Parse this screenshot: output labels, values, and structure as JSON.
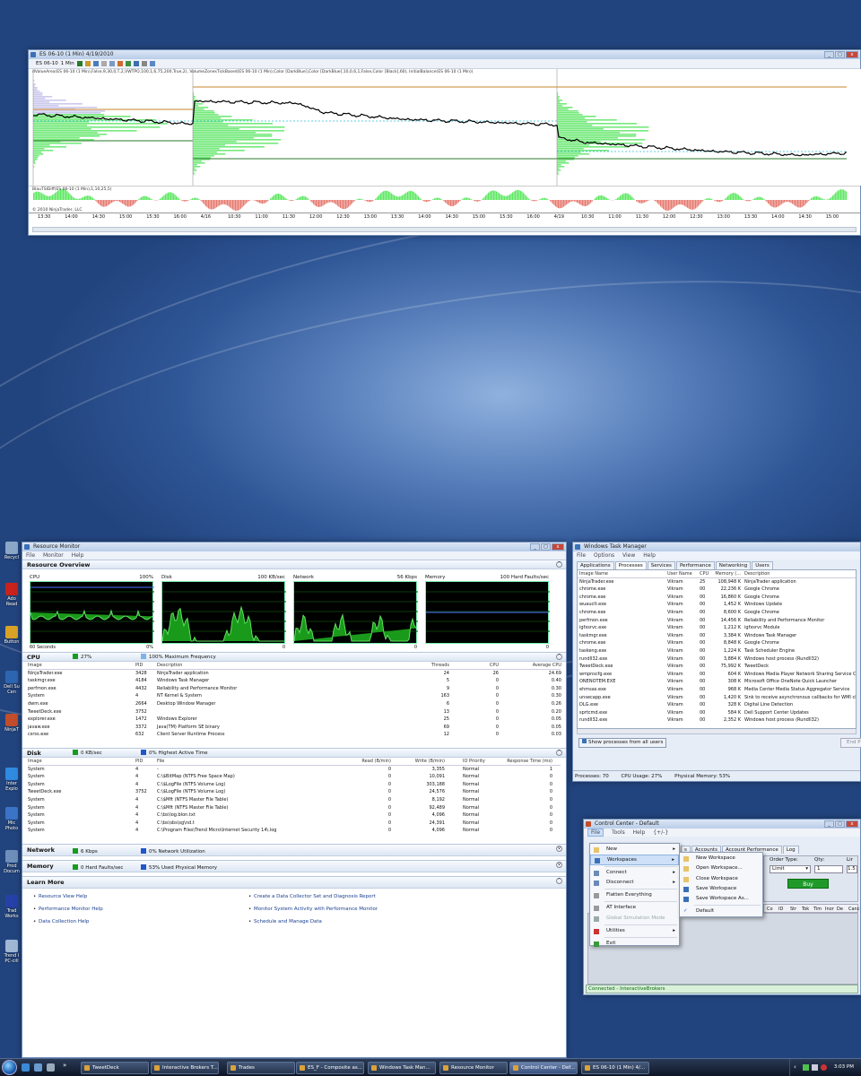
{
  "desktop": {
    "icons": [
      {
        "label": "Recycl",
        "color": "#8aa7c8"
      },
      {
        "label": "Ado Read",
        "color": "#c7221b"
      },
      {
        "label": "Button",
        "color": "#d9a227"
      },
      {
        "label": "Dell Su Cen",
        "color": "#2c66b0"
      },
      {
        "label": "NinjaT",
        "color": "#c24d2a"
      },
      {
        "label": "Inter Explo",
        "color": "#2f8ae0"
      },
      {
        "label": "Mic Photo",
        "color": "#3b74c7"
      },
      {
        "label": "Prod Docum",
        "color": "#6e8fba"
      },
      {
        "label": "Trad Works",
        "color": "#2541a8"
      },
      {
        "label": "Trend I PC-cill",
        "color": "#9fb6d4"
      }
    ]
  },
  "chart_window": {
    "title": "ES 06-10 (1 Min)  4/19/2010",
    "instrument": "ES 06-10",
    "interval": "1 Min",
    "indicator_label": "dValueArea(ES 06-10 (1 Min),False,9,30,0,T,2,VWTPO,100,1,6,75,200,True,2), VolumeZonesTickBased(ES 06-10 (1 Min),Color [DarkBlue],Color [DarkBlue],10,0,6,1,False,Color [Black],60), InitialBalance(ES 06-10 (1 Min))",
    "lower_panel_label": "BlauTSIDiff(ES 06-10 (1 Min),1,10,25,5)",
    "copyright": "© 2010 NinjaTrader, LLC",
    "x_ticks": [
      "13:30",
      "14:00",
      "14:30",
      "15:00",
      "15:30",
      "16:00",
      "4/16",
      "10:30",
      "11:00",
      "11:30",
      "12:00",
      "12:30",
      "13:00",
      "13:30",
      "14:00",
      "14:30",
      "15:00",
      "15:30",
      "16:00",
      "4/19",
      "10:30",
      "11:00",
      "11:30",
      "12:00",
      "12:30",
      "13:00",
      "13:30",
      "14:00",
      "14:30",
      "15:00"
    ]
  },
  "resource_monitor": {
    "title": "Resource Monitor",
    "menu": [
      "File",
      "Monitor",
      "Help"
    ],
    "overview_title": "Resource Overview",
    "graphs": [
      {
        "name": "CPU",
        "max": "100%",
        "left": "60 Seconds",
        "right": "0%"
      },
      {
        "name": "Disk",
        "max": "100 KB/sec",
        "left": "",
        "right": "0"
      },
      {
        "name": "Network",
        "max": "56 Kbps",
        "left": "",
        "right": "0"
      },
      {
        "name": "Memory",
        "max": "100 Hard Faults/sec",
        "left": "",
        "right": "0"
      }
    ],
    "cpu": {
      "title": "CPU",
      "usage": "27%",
      "freq": "100% Maximum Frequency",
      "headers": [
        "Image",
        "PID",
        "Description",
        "Threads",
        "CPU",
        "Average CPU"
      ],
      "rows": [
        [
          "NinjaTrader.exe",
          "3428",
          "NinjaTrader application",
          "24",
          "26",
          "24.69"
        ],
        [
          "taskmgr.exe",
          "4184",
          "Windows Task Manager",
          "5",
          "0",
          "0.40"
        ],
        [
          "perfmon.exe",
          "4432",
          "Reliability and Performance Monitor",
          "9",
          "0",
          "0.30"
        ],
        [
          "System",
          "4",
          "NT Kernel & System",
          "163",
          "0",
          "0.30"
        ],
        [
          "dwm.exe",
          "2664",
          "Desktop Window Manager",
          "6",
          "0",
          "0.26"
        ],
        [
          "TweetDeck.exe",
          "3752",
          "",
          "13",
          "0",
          "0.20"
        ],
        [
          "explorer.exe",
          "1472",
          "Windows Explorer",
          "25",
          "0",
          "0.05"
        ],
        [
          "javaw.exe",
          "3372",
          "Java(TM) Platform SE binary",
          "69",
          "0",
          "0.05"
        ],
        [
          "csrss.exe",
          "632",
          "Client Server Runtime Process",
          "12",
          "0",
          "0.03"
        ]
      ]
    },
    "disk": {
      "title": "Disk",
      "usage": "0 KB/sec",
      "active": "0% Highest Active Time",
      "headers": [
        "Image",
        "PID",
        "File",
        "Read (B/min)",
        "Write (B/min)",
        "IO Priority",
        "Response Time (ms)"
      ],
      "rows": [
        [
          "System",
          "4",
          "-",
          "0",
          "3,355",
          "Normal",
          "1"
        ],
        [
          "System",
          "4",
          "C:\\$BitMap (NTFS Free Space Map)",
          "0",
          "10,091",
          "Normal",
          "0"
        ],
        [
          "System",
          "4",
          "C:\\$LogFile (NTFS Volume Log)",
          "0",
          "303,188",
          "Normal",
          "0"
        ],
        [
          "TweetDeck.exe",
          "3752",
          "C:\\$LogFile (NTFS Volume Log)",
          "0",
          "24,576",
          "Normal",
          "0"
        ],
        [
          "System",
          "4",
          "C:\\$Mft (NTFS Master File Table)",
          "0",
          "8,192",
          "Normal",
          "0"
        ],
        [
          "System",
          "4",
          "C:\\$Mft (NTFS Master File Table)",
          "0",
          "92,489",
          "Normal",
          "0"
        ],
        [
          "System",
          "4",
          "C:\\bs\\log.blon.txt",
          "0",
          "4,096",
          "Normal",
          "0"
        ],
        [
          "System",
          "4",
          "C:\\bs\\sbs\\sg\\nd.t",
          "0",
          "24,391",
          "Normal",
          "0"
        ],
        [
          "System",
          "4",
          "C:\\Program Files\\Trend Micro\\Internet Security 14\\.log",
          "0",
          "4,096",
          "Normal",
          "0"
        ]
      ]
    },
    "network": {
      "title": "Network",
      "usage": "6 Kbps",
      "util": "0% Network Utilization"
    },
    "memory": {
      "title": "Memory",
      "usage": "0 Hard Faults/sec",
      "used": "53% Used Physical Memory"
    },
    "learn": {
      "title": "Learn More",
      "links": [
        "Resource View Help",
        "Create a Data Collector Set and Diagnosis Report",
        "Performance Monitor Help",
        "Monitor System Activity with Performance Monitor",
        "Data Collection Help",
        "Schedule and Manage Data"
      ]
    }
  },
  "task_manager": {
    "title": "Windows Task Manager",
    "menu": [
      "File",
      "Options",
      "View",
      "Help"
    ],
    "tabs": [
      "Applications",
      "Processes",
      "Services",
      "Performance",
      "Networking",
      "Users"
    ],
    "active_tab": "Processes",
    "headers": [
      "Image Name",
      "User Name",
      "CPU",
      "Memory (...",
      "Description"
    ],
    "rows": [
      [
        "NinjaTrader.exe",
        "Vikram",
        "25",
        "108,948 K",
        "NinjaTrader application"
      ],
      [
        "chrome.exe",
        "Vikram",
        "00",
        "22,236 K",
        "Google Chrome"
      ],
      [
        "chrome.exe",
        "Vikram",
        "00",
        "16,860 K",
        "Google Chrome"
      ],
      [
        "wuauclt.exe",
        "Vikram",
        "00",
        "1,452 K",
        "Windows Update"
      ],
      [
        "chrome.exe",
        "Vikram",
        "00",
        "8,600 K",
        "Google Chrome"
      ],
      [
        "perfmon.exe",
        "Vikram",
        "00",
        "14,456 K",
        "Reliability and Performance Monitor"
      ],
      [
        "igfxsrvc.exe",
        "Vikram",
        "00",
        "1,212 K",
        "igfxsrvc Module"
      ],
      [
        "taskmgr.exe",
        "Vikram",
        "00",
        "3,384 K",
        "Windows Task Manager"
      ],
      [
        "chrome.exe",
        "Vikram",
        "00",
        "8,848 K",
        "Google Chrome"
      ],
      [
        "taskeng.exe",
        "Vikram",
        "00",
        "1,224 K",
        "Task Scheduler Engine"
      ],
      [
        "rundll32.exe",
        "Vikram",
        "00",
        "3,884 K",
        "Windows host process (Rundll32)"
      ],
      [
        "TweetDeck.exe",
        "Vikram",
        "00",
        "75,992 K",
        "TweetDeck"
      ],
      [
        "wmpnscfg.exe",
        "Vikram",
        "00",
        "604 K",
        "Windows Media Player Network Sharing Service Conf"
      ],
      [
        "ONENOTEM.EXE",
        "Vikram",
        "00",
        "308 K",
        "Microsoft Office OneNote Quick Launcher"
      ],
      [
        "ehmsas.exe",
        "Vikram",
        "00",
        "968 K",
        "Media Center Media Status Aggregator Service"
      ],
      [
        "unsecapp.exe",
        "Vikram",
        "00",
        "1,420 K",
        "Sink to receive asynchronous callbacks for WMI clien"
      ],
      [
        "DLG.exe",
        "Vikram",
        "00",
        "328 K",
        "Digital Line Detection"
      ],
      [
        "sprtcmd.exe",
        "Vikram",
        "00",
        "584 K",
        "Dell Support Center Updates"
      ],
      [
        "rundll32.exe",
        "Vikram",
        "00",
        "2,352 K",
        "Windows host process (Rundll32)"
      ]
    ],
    "show_all": "Show processes from all users",
    "end_btn": "End P",
    "status": [
      "Processes: 70",
      "CPU Usage: 27%",
      "Physical Memory: 53%"
    ]
  },
  "control_center": {
    "title": "Control Center - Default",
    "menu": [
      "File",
      "Tools",
      "Help",
      "{+/-}"
    ],
    "tabs": [
      "s",
      "Accounts",
      "Account Performance",
      "Log"
    ],
    "order_labels": [
      "Order Type:",
      "Qty:",
      "Lir"
    ],
    "order_type": "Limit",
    "qty": "1",
    "buy": "Buy",
    "cols": [
      "Co",
      "ID",
      "Str",
      "Tok",
      "Tim",
      "Inor",
      "De",
      "Canc"
    ],
    "status": "Connected - InteractiveBrokers",
    "file_menu": [
      {
        "label": "New",
        "arrow": true
      },
      {
        "label": "Workspaces",
        "arrow": true,
        "hl": true
      },
      {
        "label": "Connect",
        "arrow": true,
        "sep": true
      },
      {
        "label": "Disconnect",
        "arrow": true
      },
      {
        "label": "Flatten Everything",
        "sep": true
      },
      {
        "label": "AT Interface",
        "sep": true
      },
      {
        "label": "Global Simulation Mode",
        "dis": true
      },
      {
        "label": "Utilities",
        "arrow": true,
        "sep": true
      },
      {
        "label": "Exit",
        "sep": true
      }
    ],
    "workspaces_menu": [
      "New Workspace",
      "Open Workspace...",
      "Close Workspace",
      "Save Workspace",
      "Save Workspace As...",
      "Default"
    ]
  },
  "taskbar": {
    "buttons": [
      "TweetDeck",
      "Interactive Brokers T...",
      "Trades",
      "ES_F - Composite as...",
      "Windows Task Man...",
      "Resource Monitor",
      "Control Center - Def...",
      "ES 06-10 (1 Min)  4/..."
    ],
    "active": "Control Center - Def...",
    "clock": "3:03 PM"
  },
  "colors": {
    "accent": "#2f5696",
    "volume_profile": "#35e23a",
    "negative": "#e05a4e"
  }
}
